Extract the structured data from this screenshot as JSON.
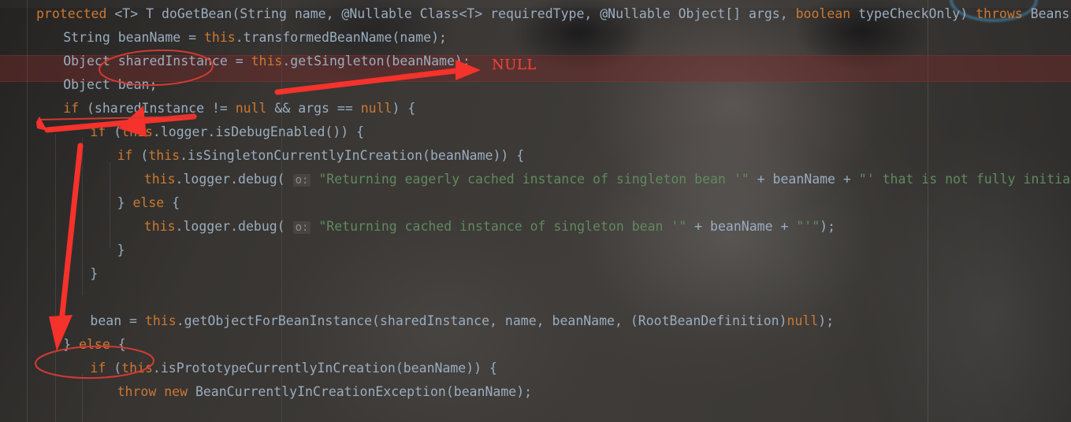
{
  "editor": {
    "app": "code-editor",
    "language": "java",
    "background_image": "cat-photo",
    "current_line_number": 3,
    "font_size_px": 16.5,
    "line_height_px": 30
  },
  "colors": {
    "editor_background": "#3a3734",
    "default_text": "#9aadc0",
    "keyword": "#cc7832",
    "string": "#5f8a5f",
    "annotation_red": "#e8413a",
    "current_line_highlight": "#7d2828",
    "collar_blue": "#467da0"
  },
  "code_lines": [
    {
      "indent": 0,
      "tokens": [
        {
          "t": "protected ",
          "c": "kw"
        },
        {
          "t": "<T> T doGetBean",
          "c": "plain"
        },
        {
          "t": "(String name, @Nullable Class<T> requiredType, @Nullable Object[] args, ",
          "c": "plain"
        },
        {
          "t": "boolean ",
          "c": "kw"
        },
        {
          "t": "typeCheckOnly) ",
          "c": "plain"
        },
        {
          "t": "throws ",
          "c": "kw"
        },
        {
          "t": "BeansEx",
          "c": "plain"
        }
      ]
    },
    {
      "indent": 1,
      "tokens": [
        {
          "t": "String beanName = ",
          "c": "plain"
        },
        {
          "t": "this",
          "c": "kw"
        },
        {
          "t": ".transformedBeanName(name);",
          "c": "plain"
        }
      ]
    },
    {
      "indent": 1,
      "tokens": [
        {
          "t": "Object sharedInstance = ",
          "c": "plain"
        },
        {
          "t": "this",
          "c": "kw"
        },
        {
          "t": ".getSingleton(beanName);",
          "c": "plain"
        }
      ]
    },
    {
      "indent": 1,
      "tokens": [
        {
          "t": "Object bean;",
          "c": "plain"
        }
      ]
    },
    {
      "indent": 1,
      "tokens": [
        {
          "t": "if ",
          "c": "kw"
        },
        {
          "t": "(sharedInstance != ",
          "c": "plain"
        },
        {
          "t": "null ",
          "c": "kw"
        },
        {
          "t": "&& args == ",
          "c": "plain"
        },
        {
          "t": "null",
          "c": "kw"
        },
        {
          "t": ") {",
          "c": "plain"
        }
      ]
    },
    {
      "indent": 2,
      "tokens": [
        {
          "t": "if ",
          "c": "kw"
        },
        {
          "t": "(",
          "c": "plain"
        },
        {
          "t": "this",
          "c": "kw"
        },
        {
          "t": ".logger.isDebugEnabled()) {",
          "c": "plain"
        }
      ]
    },
    {
      "indent": 3,
      "tokens": [
        {
          "t": "if ",
          "c": "kw"
        },
        {
          "t": "(",
          "c": "plain"
        },
        {
          "t": "this",
          "c": "kw"
        },
        {
          "t": ".isSingletonCurrentlyInCreation(beanName)) {",
          "c": "plain"
        }
      ]
    },
    {
      "indent": 4,
      "tokens": [
        {
          "t": "this",
          "c": "kw"
        },
        {
          "t": ".logger.debug( ",
          "c": "plain"
        },
        {
          "t": "o:",
          "c": "hint"
        },
        {
          "t": " \"Returning eagerly cached instance of singleton bean '\"",
          "c": "str"
        },
        {
          "t": " + beanName + ",
          "c": "plain"
        },
        {
          "t": "\"' that is not fully initial",
          "c": "str"
        }
      ]
    },
    {
      "indent": 3,
      "tokens": [
        {
          "t": "} ",
          "c": "plain"
        },
        {
          "t": "else ",
          "c": "kw"
        },
        {
          "t": "{",
          "c": "plain"
        }
      ]
    },
    {
      "indent": 4,
      "tokens": [
        {
          "t": "this",
          "c": "kw"
        },
        {
          "t": ".logger.debug( ",
          "c": "plain"
        },
        {
          "t": "o:",
          "c": "hint"
        },
        {
          "t": " \"Returning cached instance of singleton bean '\"",
          "c": "str"
        },
        {
          "t": " + beanName + ",
          "c": "plain"
        },
        {
          "t": "\"'\"",
          "c": "str"
        },
        {
          "t": ");",
          "c": "plain"
        }
      ]
    },
    {
      "indent": 3,
      "tokens": [
        {
          "t": "}",
          "c": "plain"
        }
      ]
    },
    {
      "indent": 2,
      "tokens": [
        {
          "t": "}",
          "c": "plain"
        }
      ]
    },
    {
      "indent": 0,
      "tokens": [
        {
          "t": "",
          "c": "plain"
        }
      ]
    },
    {
      "indent": 2,
      "tokens": [
        {
          "t": "bean = ",
          "c": "plain"
        },
        {
          "t": "this",
          "c": "kw"
        },
        {
          "t": ".getObjectForBeanInstance(sharedInstance, name, beanName, (RootBeanDefinition)",
          "c": "plain"
        },
        {
          "t": "null",
          "c": "kw"
        },
        {
          "t": ");",
          "c": "plain"
        }
      ]
    },
    {
      "indent": 1,
      "tokens": [
        {
          "t": "} ",
          "c": "plain"
        },
        {
          "t": "else ",
          "c": "kw"
        },
        {
          "t": "{",
          "c": "plain"
        }
      ]
    },
    {
      "indent": 2,
      "tokens": [
        {
          "t": "if ",
          "c": "kw"
        },
        {
          "t": "(",
          "c": "plain"
        },
        {
          "t": "this",
          "c": "kw"
        },
        {
          "t": ".isPrototypeCurrentlyInCreation(beanName)) {",
          "c": "plain"
        }
      ]
    },
    {
      "indent": 3,
      "tokens": [
        {
          "t": "throw new ",
          "c": "kw"
        },
        {
          "t": "BeanCurrentlyInCreationException(beanName);",
          "c": "plain"
        }
      ]
    }
  ],
  "annotations": {
    "null_label": "NULL",
    "ellipses": [
      {
        "name": "shared-instance-ellipse",
        "target": "sharedInstance"
      },
      {
        "name": "else-branch-ellipse",
        "target": "} else {"
      }
    ],
    "arrows": [
      {
        "name": "null-pointer-arrow",
        "direction": "right",
        "points_to": "NULL"
      },
      {
        "name": "shared-instance-check-arrow",
        "direction": "left",
        "points_to": "if (sharedInstance"
      },
      {
        "name": "else-branch-arrow",
        "direction": "down",
        "points_to": "} else {"
      }
    ]
  }
}
